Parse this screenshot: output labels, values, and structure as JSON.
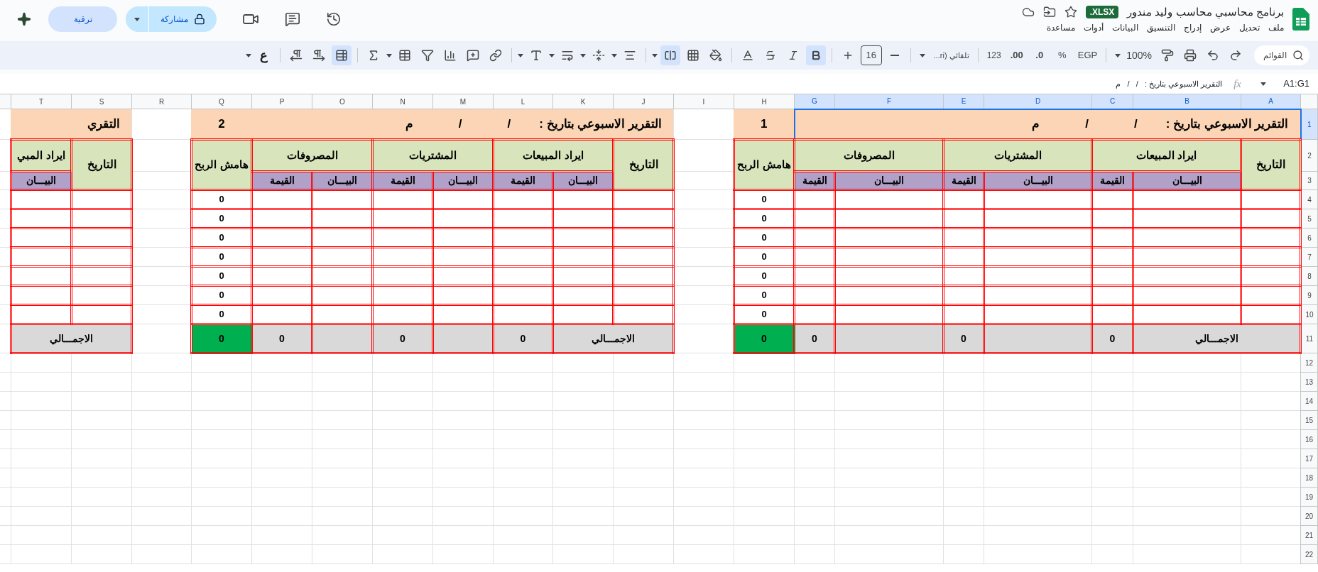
{
  "app": {
    "title": "برنامج محاسبي محاسب وليد مندور",
    "badge": "XLSX.",
    "menus": [
      "ملف",
      "تحديل",
      "عرض",
      "إدراج",
      "التنسيق",
      "البيانات",
      "أدوات",
      "مساعدة"
    ],
    "share_label": "مشاركة",
    "upgrade_label": "ترقية"
  },
  "toolbar": {
    "search_placeholder": "القوائم",
    "zoom": "100%",
    "currency": "EGP",
    "percent": "%",
    "decrease_decimals": ".0",
    "increase_decimals": ".00",
    "number_format": "123",
    "font": "تلقائي (ri...",
    "font_size": "16",
    "input_tool": "ع",
    "bold_on": true,
    "merge_on": true,
    "table_on": true
  },
  "formula_bar": {
    "name_box": "A1:G1",
    "fx": "fx",
    "formula": "التقرير الاسبوعي بتاريخ :   /   /   م"
  },
  "columns": [
    {
      "label": "A",
      "selected": true
    },
    {
      "label": "B",
      "selected": true
    },
    {
      "label": "C",
      "selected": true
    },
    {
      "label": "D",
      "selected": true
    },
    {
      "label": "E",
      "selected": true
    },
    {
      "label": "F",
      "selected": true
    },
    {
      "label": "G",
      "selected": true
    },
    {
      "label": "H",
      "selected": false
    },
    {
      "label": "I",
      "selected": false
    },
    {
      "label": "J",
      "selected": false
    },
    {
      "label": "K",
      "selected": false
    },
    {
      "label": "L",
      "selected": false
    },
    {
      "label": "M",
      "selected": false
    },
    {
      "label": "N",
      "selected": false
    },
    {
      "label": "O",
      "selected": false
    },
    {
      "label": "P",
      "selected": false
    },
    {
      "label": "Q",
      "selected": false
    },
    {
      "label": "R",
      "selected": false
    },
    {
      "label": "S",
      "selected": false
    },
    {
      "label": "T",
      "selected": false
    }
  ],
  "rows": [
    {
      "label": "1",
      "selected": true
    },
    {
      "label": "2",
      "selected": false
    },
    {
      "label": "3",
      "selected": false
    },
    {
      "label": "4",
      "selected": false
    },
    {
      "label": "5",
      "selected": false
    },
    {
      "label": "6",
      "selected": false
    },
    {
      "label": "7",
      "selected": false
    },
    {
      "label": "8",
      "selected": false
    },
    {
      "label": "9",
      "selected": false
    },
    {
      "label": "10",
      "selected": false
    },
    {
      "label": "11",
      "selected": false
    },
    {
      "label": "12",
      "selected": false
    },
    {
      "label": "13",
      "selected": false
    },
    {
      "label": "14",
      "selected": false
    },
    {
      "label": "15",
      "selected": false
    },
    {
      "label": "16",
      "selected": false
    },
    {
      "label": "17",
      "selected": false
    },
    {
      "label": "18",
      "selected": false
    },
    {
      "label": "19",
      "selected": false
    },
    {
      "label": "20",
      "selected": false
    },
    {
      "label": "21",
      "selected": false
    },
    {
      "label": "22",
      "selected": false
    }
  ],
  "reports": [
    {
      "title": "التقرير الاسبوعي بتاريخ :",
      "date_marks": [
        "/",
        "/",
        "م"
      ],
      "number": "1",
      "title_selected": true,
      "date_header": "التاريخ",
      "groups": [
        {
          "title": "ايراد المبيعات",
          "subs": [
            "البيـــان",
            "القيمة"
          ]
        },
        {
          "title": "المشتريات",
          "subs": [
            "البيـــان",
            "القيمة"
          ]
        },
        {
          "title": "المصروفات",
          "subs": [
            "البيـــان",
            "القيمة"
          ]
        }
      ],
      "profit_header": "هامش الربح",
      "profits": [
        "0",
        "0",
        "0",
        "0",
        "0",
        "0",
        "0"
      ],
      "total_label": "الاجمـــالي",
      "totals": [
        "0",
        "0",
        "0"
      ],
      "profit_total": "0"
    },
    {
      "title": "التقرير الاسبوعي بتاريخ :",
      "date_marks": [
        "/",
        "/",
        "م"
      ],
      "number": "2",
      "title_selected": false,
      "date_header": "التاريخ",
      "groups": [
        {
          "title": "ايراد المبيعات",
          "subs": [
            "البيـــان",
            "القيمة"
          ]
        },
        {
          "title": "المشتريات",
          "subs": [
            "البيـــان",
            "القيمة"
          ]
        },
        {
          "title": "المصروفات",
          "subs": [
            "البيـــان",
            "القيمة"
          ]
        }
      ],
      "profit_header": "هامش الربح",
      "profits": [
        "0",
        "0",
        "0",
        "0",
        "0",
        "0",
        "0"
      ],
      "total_label": "الاجمـــالي",
      "totals": [
        "0",
        "0",
        "0"
      ],
      "profit_total": "0"
    },
    {
      "title": "التقري",
      "title_selected": false,
      "date_header": "التاريخ",
      "groups": [
        {
          "title": "ايراد المبي",
          "subs": [
            "البيـــان"
          ]
        }
      ],
      "total_label": "الاجمـــالي"
    }
  ]
}
